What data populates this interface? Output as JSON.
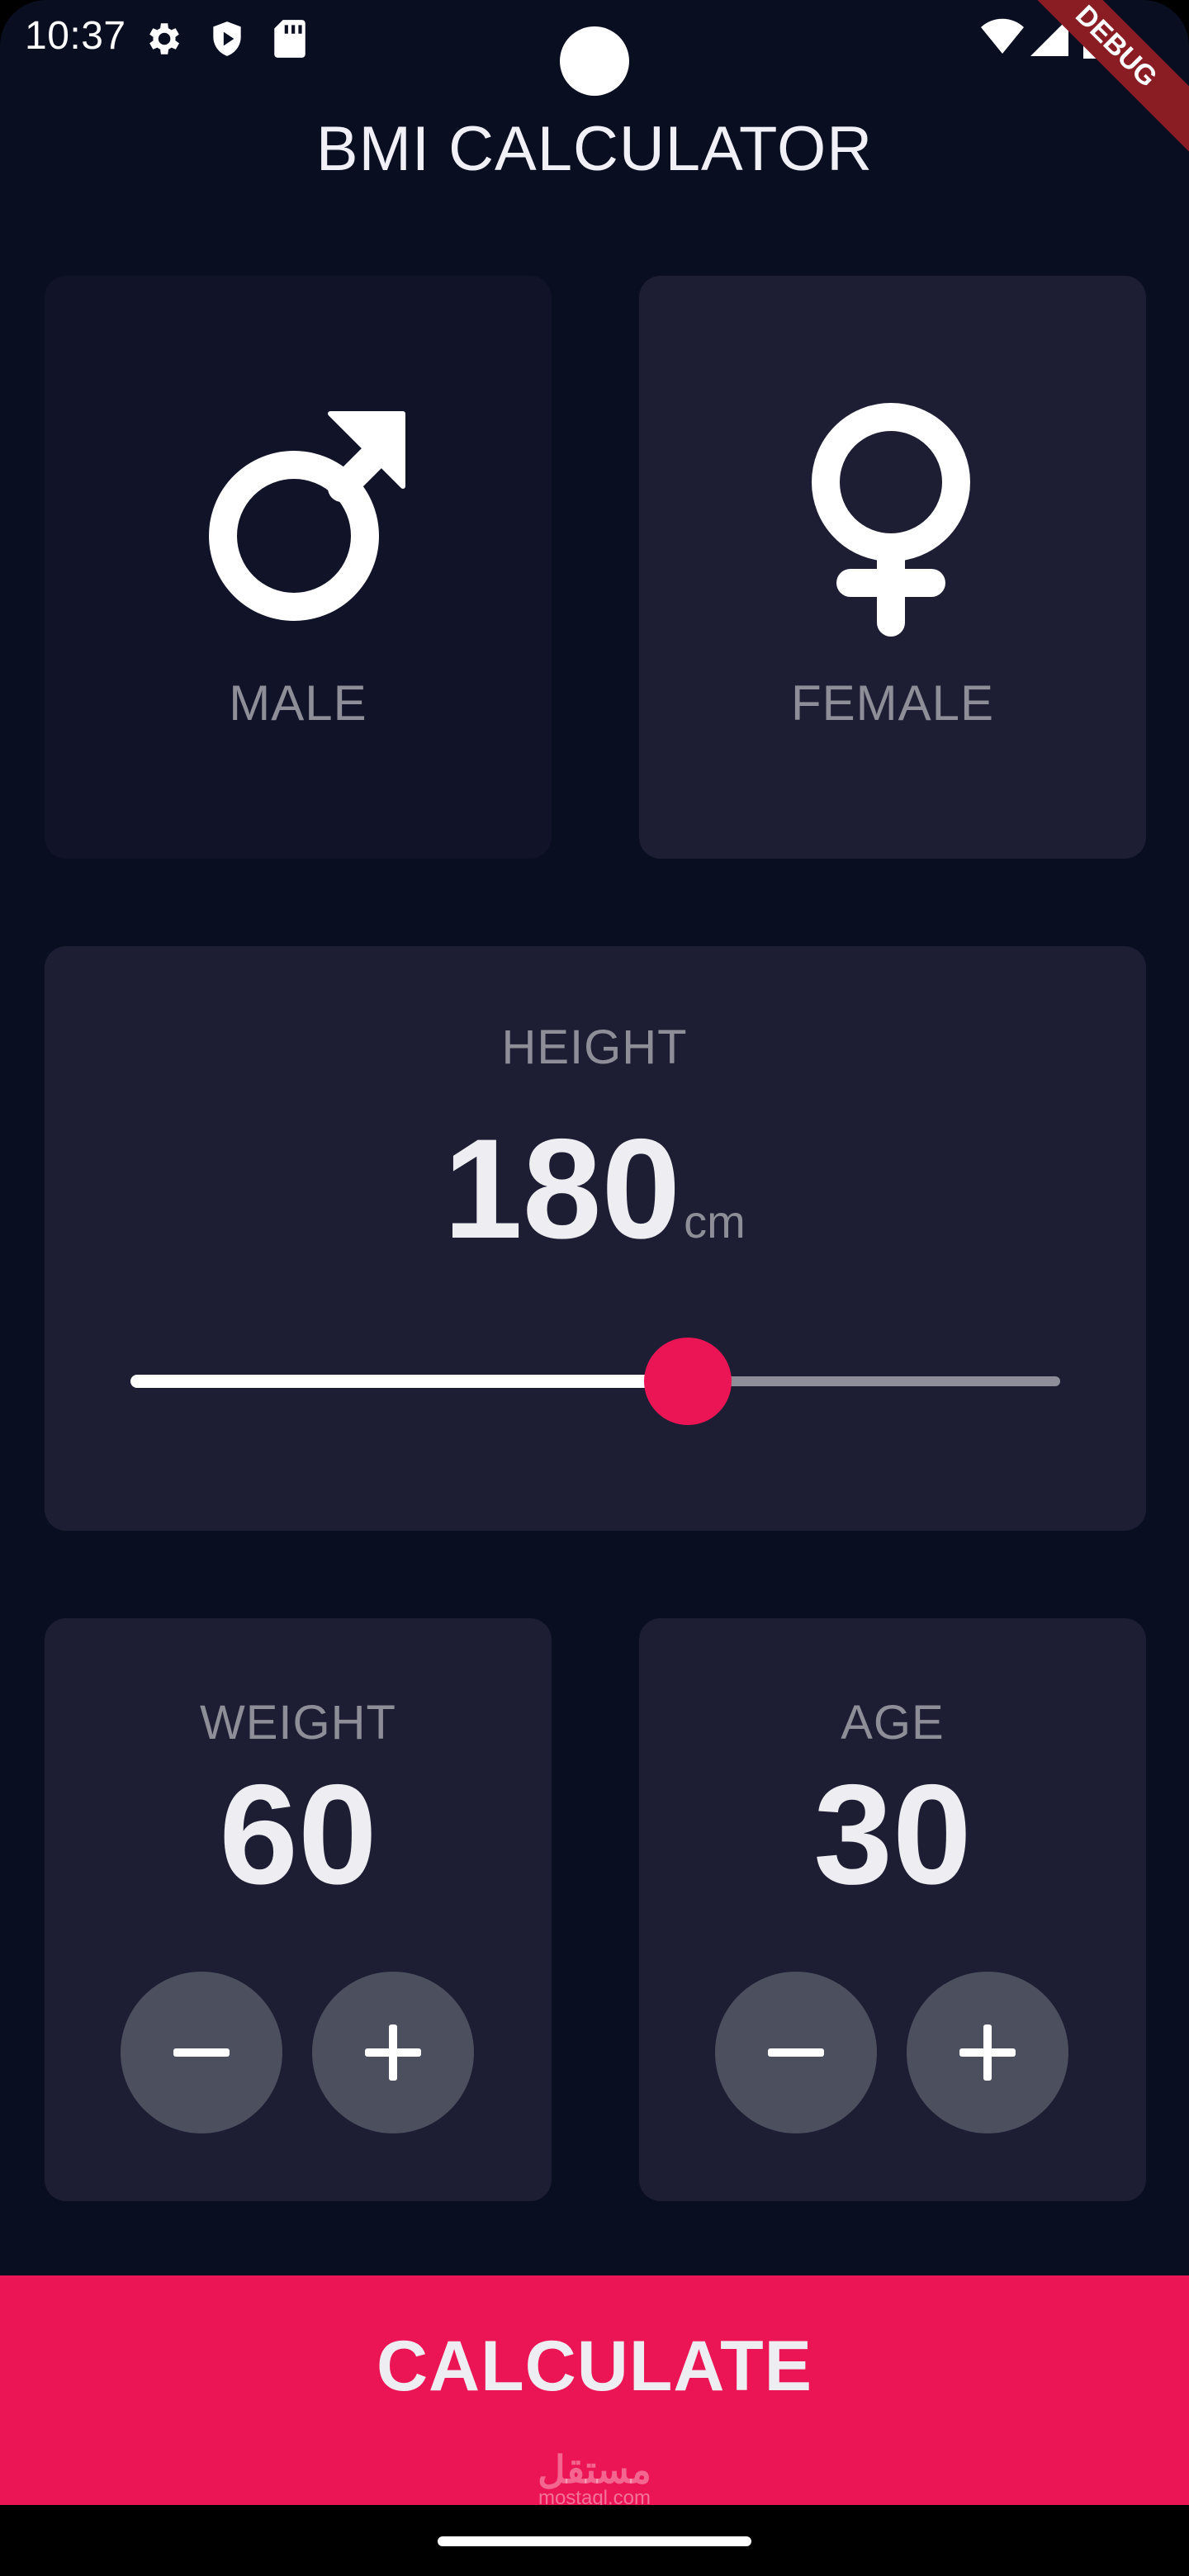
{
  "status_bar": {
    "time": "10:37",
    "icons": [
      "gear-icon",
      "shield-icon",
      "sd-card-icon",
      "wifi-icon",
      "signal-icon",
      "battery-icon"
    ],
    "debug_banner": "DEBUG"
  },
  "app": {
    "title": "BMI CALCULATOR"
  },
  "gender": {
    "male": {
      "label": "MALE",
      "icon": "mars-icon"
    },
    "female": {
      "label": "FEMALE",
      "icon": "venus-icon"
    }
  },
  "height": {
    "label": "HEIGHT",
    "value": "180",
    "unit": "cm",
    "slider_fraction": 0.6
  },
  "weight": {
    "label": "WEIGHT",
    "value": "60"
  },
  "age": {
    "label": "AGE",
    "value": "30"
  },
  "calculate": {
    "label": "CALCULATE"
  },
  "watermark": {
    "arabic": "مستقل",
    "latin": "mostaql.com"
  },
  "colors": {
    "background": "#0A0E21",
    "card": "#1D1E33",
    "accent": "#EB1555",
    "label": "#8D8E98",
    "button": "#4C4F5E"
  }
}
